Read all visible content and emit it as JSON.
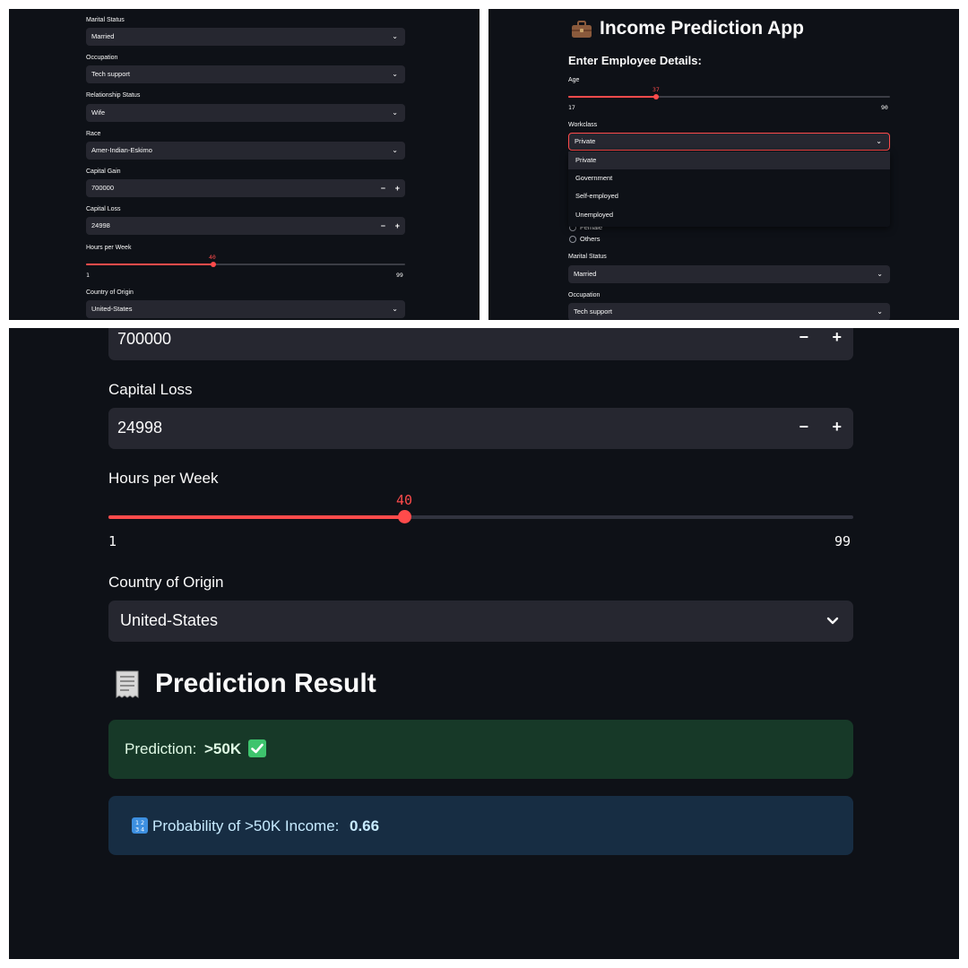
{
  "left_panel": {
    "marital": {
      "label": "Marital Status",
      "value": "Married"
    },
    "occupation": {
      "label": "Occupation",
      "value": "Tech support"
    },
    "relationship": {
      "label": "Relationship Status",
      "value": "Wife"
    },
    "race": {
      "label": "Race",
      "value": "Amer-Indian-Eskimo"
    },
    "capital_gain": {
      "label": "Capital Gain",
      "value": "700000"
    },
    "capital_loss": {
      "label": "Capital Loss",
      "value": "24998"
    },
    "hours": {
      "label": "Hours per Week",
      "value": 40,
      "value_text": "40",
      "min": "1",
      "max": "99"
    },
    "country": {
      "label": "Country of Origin",
      "value": "United-States"
    }
  },
  "right_panel": {
    "app_icon": "briefcase-icon",
    "app_title": "Income Prediction App",
    "section_title": "Enter Employee Details:",
    "age": {
      "label": "Age",
      "value": 37,
      "value_text": "37",
      "min": "17",
      "max": "90"
    },
    "workclass": {
      "label": "Workclass",
      "value": "Private",
      "options": [
        "Private",
        "Government",
        "Self-employed",
        "Unemployed"
      ]
    },
    "gender_options_visible": [
      "Female",
      "Others"
    ],
    "marital": {
      "label": "Marital Status",
      "value": "Married"
    },
    "occupation": {
      "label": "Occupation",
      "value": "Tech support"
    }
  },
  "bottom_panel": {
    "capital_gain_value": "700000",
    "capital_loss": {
      "label": "Capital Loss",
      "value": "24998"
    },
    "hours": {
      "label": "Hours per Week",
      "value": 40,
      "value_text": "40",
      "min": "1",
      "max": "99"
    },
    "country": {
      "label": "Country of Origin",
      "value": "United-States"
    },
    "result_icon": "receipt-icon",
    "result_title": "Prediction Result",
    "prediction": {
      "prefix": "Prediction: ",
      "value": ">50K",
      "icon": "check-mark-icon"
    },
    "probability": {
      "icon": "numbers-icon",
      "prefix": "Probability of >50K Income: ",
      "value": "0.66"
    }
  },
  "colors": {
    "background": "#0e1117",
    "widget": "#262730",
    "accent": "#ff4b4b",
    "success_bg": "#173928",
    "success_text": "#dff8e4",
    "info_bg": "#172d43",
    "info_text": "#c7ebff"
  }
}
